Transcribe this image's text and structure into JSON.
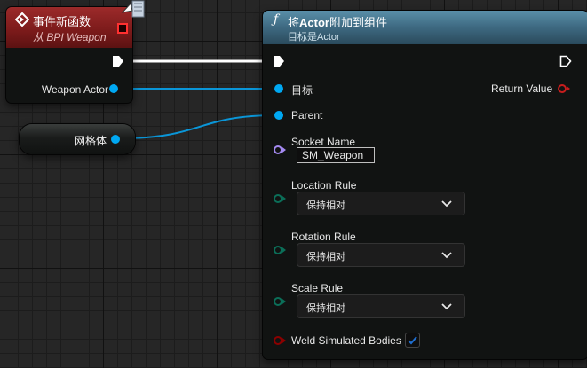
{
  "event_node": {
    "title": "事件新函数",
    "subtitle": "从 BPI Weapon",
    "output_pin_label": "Weapon Actor"
  },
  "mesh_node": {
    "label": "网格体"
  },
  "attach_node": {
    "title_prefix": "将",
    "title_bold": "Actor",
    "title_suffix": "附加到组件",
    "subtitle": "目标是Actor",
    "target_label": "目标",
    "return_label": "Return Value",
    "parent_label": "Parent",
    "socket_name_label": "Socket Name",
    "socket_name_value": "SM_Weapon",
    "location_rule_label": "Location Rule",
    "location_rule_value": "保持相对",
    "rotation_rule_label": "Rotation Rule",
    "rotation_rule_value": "保持相对",
    "scale_rule_label": "Scale Rule",
    "scale_rule_value": "保持相对",
    "weld_label": "Weld Simulated Bodies",
    "weld_checked": true
  },
  "colors": {
    "event_header": "#9c2a2a",
    "function_header": "#4f7f99",
    "object_pin": "#00a8f2",
    "exec_wire": "#ffffff",
    "name_pin": "#a48af0",
    "enum_pin": "#0b6e58",
    "bool_pin": "#8c0000",
    "checkbox_accent": "#1f6fd1"
  },
  "icons": [
    "event-diamond-icon",
    "function-icon",
    "exec-pin-icon",
    "chevron-down-icon",
    "checkmark-icon",
    "delegate-pin-icon",
    "cursor-icon"
  ]
}
